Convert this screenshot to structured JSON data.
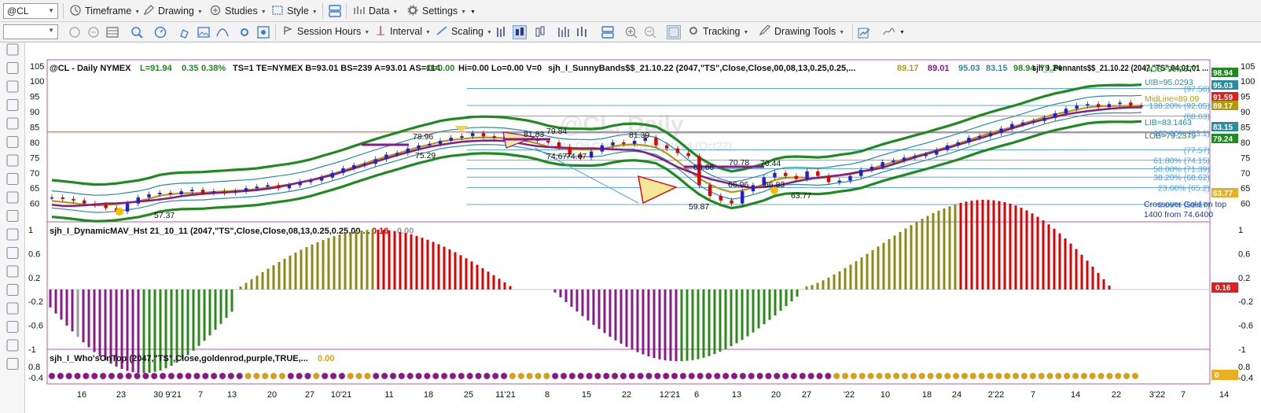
{
  "toolbar1": {
    "symbol": "@CL",
    "timeframe": "Timeframe",
    "drawing": "Drawing",
    "studies": "Studies",
    "style": "Style",
    "data": "Data",
    "settings": "Settings"
  },
  "toolbar2": {
    "session_hours": "Session Hours",
    "interval": "Interval",
    "scaling": "Scaling",
    "tracking": "Tracking",
    "drawing_tools": "Drawing Tools"
  },
  "header": {
    "symbol": "@CL - Daily  NYMEX",
    "L": "L=91.94",
    "chg": "0.35",
    "pct": "0.38%",
    "rest": "TS=1  TE=NYMEX  B=93.01  BS=239  A=93.01  AS=114",
    "o": "O=0.00",
    "hilo": "Hi=0.00  Lo=0.00  V=0",
    "sunny": "sjh_I_SunnyBands$$_21.10.22 (2047,\"TS\",Close,Close,00,08,13,0.25,0.25,...",
    "v1": "89.17",
    "v2": "89.01",
    "v3": "95.03",
    "v4": "83.15",
    "v5": "98.94",
    "v6": "79.24",
    "pennants": "sjh_I_Pennants$$_21.10.22 (2047,\"TS\",04,01,01 ..."
  },
  "watermark": {
    "title": "@CL, Daily",
    "sub": "Crude Oil Continuous Contract (Oct22)"
  },
  "colors": {
    "up": "#2020d0",
    "down": "#e00000",
    "band_outer": "#1f8a1f",
    "band_inner": "#2a8ca0",
    "mid": "#b09a10",
    "mav": "#8a1a8a",
    "fib": "#4a9ee8",
    "hline": "#ff6a3a",
    "olive": "#8a8a14",
    "green": "#2a8a1a",
    "purple": "#8a1a8a",
    "gray": "#9a9a9a",
    "gold": "#d8a01a"
  },
  "price_axis": [
    "105",
    "100",
    "95",
    "90",
    "85",
    "80",
    "75",
    "70",
    "65",
    "60"
  ],
  "date_axis": [
    "16",
    "23",
    "30 9'21",
    "7",
    "13",
    "20",
    "27",
    "10'21",
    "11",
    "18",
    "25",
    "11'21",
    "8",
    "15",
    "22",
    "12'21",
    "6",
    "13",
    "20",
    "27",
    "'22",
    "10",
    "18",
    "24",
    "2'22",
    "7",
    "14",
    "22",
    "3'22",
    "7",
    "14"
  ],
  "price_labels": [
    "57.37",
    "78.96",
    "75.29",
    "81.83",
    "79.84",
    "74.67",
    "74.67",
    "81.39",
    "59.87",
    "68.66",
    "70.78",
    "66.96",
    "70.44",
    "66.83",
    "63.77"
  ],
  "band_labels": {
    "uob": "UOB=98.9377",
    "uib": "UIB=95.0293",
    "mid": "MidLine=89.09",
    "lib": "LIB=83.1463",
    "lob": "LOB=79.2379"
  },
  "fib_labels": [
    "(97.58)",
    "138.20% (92.05)",
    "(88.63)",
    "100.00% (83.1)",
    "(77.57)",
    "61.80% (74.15)",
    "50.00% (71.39)",
    "38.20% (68.62)",
    "23.60% (65.2)",
    "0.00% (59.67)"
  ],
  "crossover": {
    "line1": "Crossover Gold on top",
    "line2": "1400 from 74.6400"
  },
  "price_badges": [
    "98.94",
    "95.03",
    "91.59",
    "89.17",
    "83.15",
    "79.24",
    "63.77"
  ],
  "pane2": {
    "title": "sjh_I_DynamicMAV_Hst 21_10_11 (2047,\"TS\",Close,Close,08,13,0.25,0.25,00,...",
    "v1": "0.16",
    "v2": "0.00",
    "axis": [
      "1",
      "0.6",
      "0.2",
      "-0.2",
      "-0.6",
      "-1"
    ],
    "badge": "0.16"
  },
  "pane3": {
    "title": "sjh_I_Who'sOnTop (2047,\"TS\",Close,goldenrod,purple,TRUE,...",
    "v1": "0.00",
    "axis": [
      "0.8",
      "-0.4"
    ],
    "badge": "0"
  },
  "chart_data": {
    "type": "ohlc+indicators",
    "symbol": "@CL",
    "interval": "Daily",
    "last_close": 91.94,
    "close_approx": [
      62,
      61.5,
      61,
      60,
      59.5,
      58.5,
      57.4,
      60,
      62,
      63,
      63.5,
      63,
      64,
      64.5,
      63.5,
      64,
      63.5,
      64,
      65,
      65.5,
      66,
      65,
      66,
      67,
      67.5,
      68.5,
      70,
      71.5,
      72.5,
      73,
      74.5,
      76,
      76.5,
      78,
      79,
      79.5,
      80.5,
      81.5,
      82,
      83,
      82,
      81.5,
      82,
      81.5,
      81,
      80.5,
      80,
      78.5,
      76,
      75,
      77,
      79,
      80,
      79.5,
      80.5,
      81.5,
      79,
      78,
      76.5,
      75.5,
      66,
      62.5,
      61,
      60,
      64,
      66,
      68.5,
      70,
      69,
      68,
      70.5,
      69,
      67,
      67.5,
      69,
      71,
      72,
      73.5,
      74,
      75,
      75.5,
      76,
      77.5,
      79,
      80,
      81.5,
      82,
      83,
      84.5,
      86,
      86.5,
      87,
      88,
      89.5,
      91,
      92,
      92.5,
      91.5,
      92.5,
      93,
      92,
      91.9
    ]
  }
}
